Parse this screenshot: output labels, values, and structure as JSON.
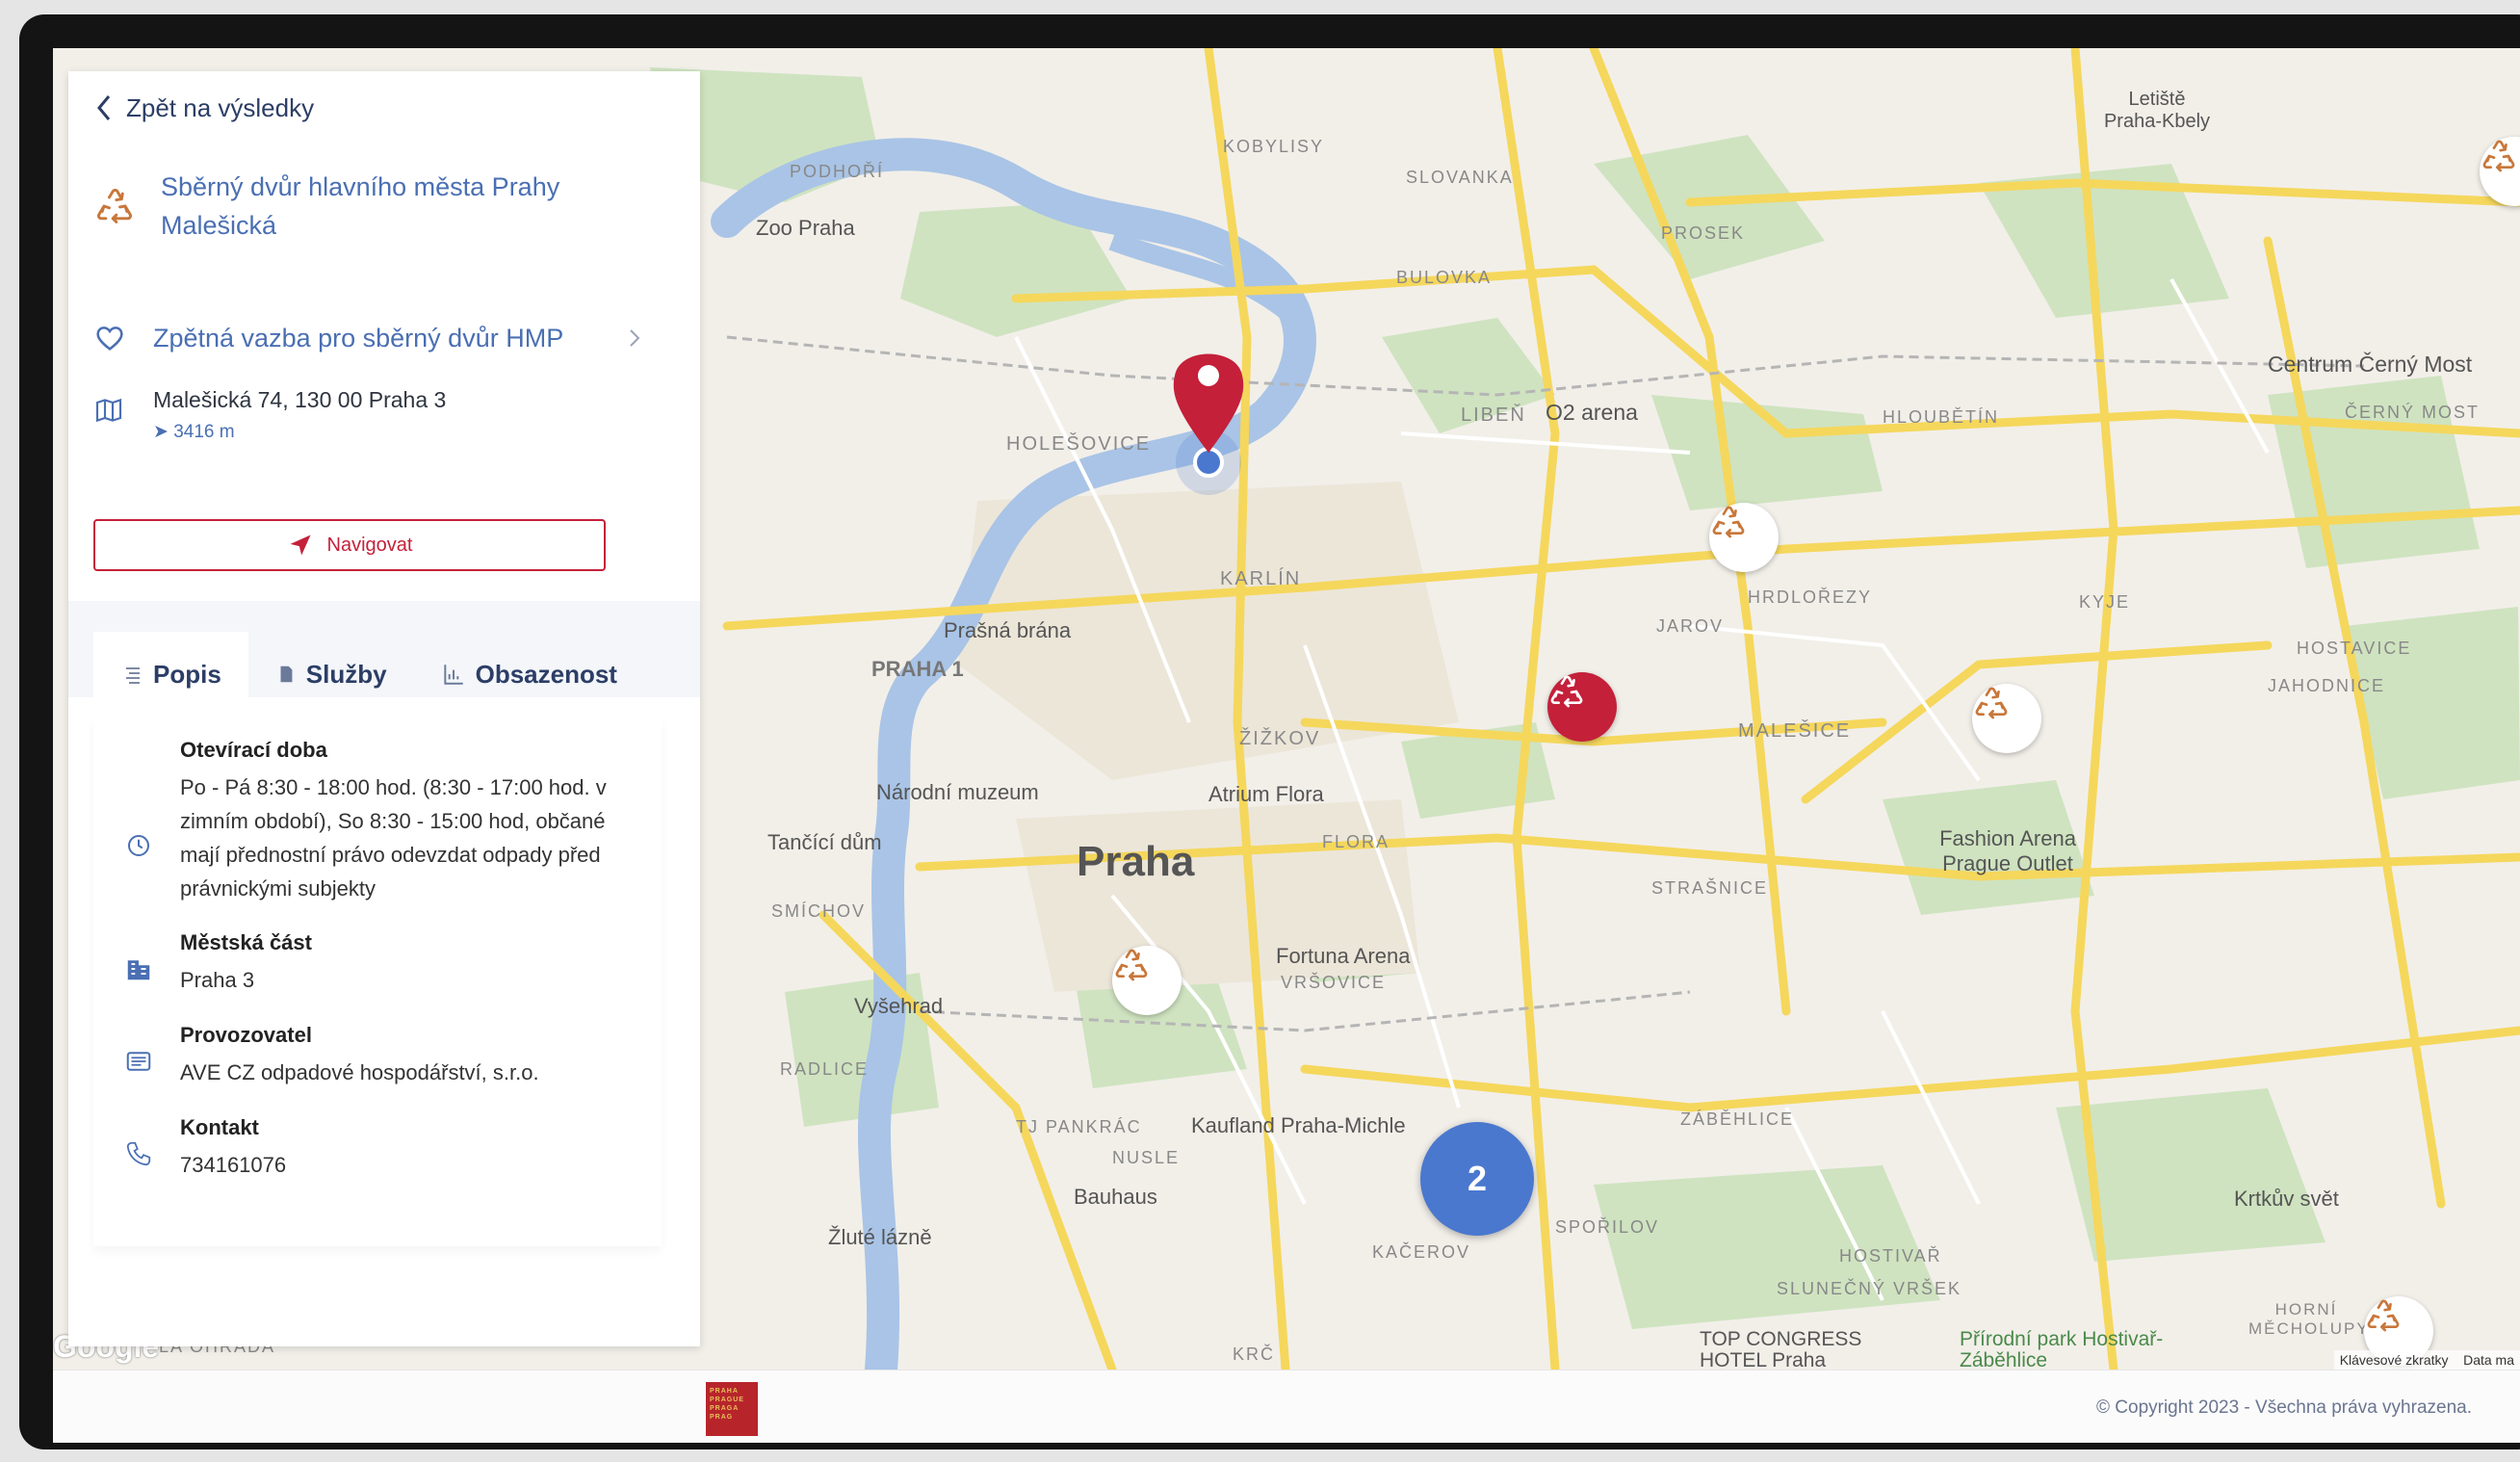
{
  "panel": {
    "back_label": "Zpět na výsledky",
    "title": "Sběrný dvůr hlavního města Prahy Malešická",
    "feedback_label": "Zpětná vazba pro sběrný dvůr HMP",
    "address": "Malešická 74, 130 00 Praha 3",
    "distance": "3416 m",
    "navigate_label": "Navigovat",
    "tabs": [
      {
        "label": "Popis",
        "icon": "list-icon"
      },
      {
        "label": "Služby",
        "icon": "document-icon"
      },
      {
        "label": "Obsazenost",
        "icon": "bar-chart-icon"
      }
    ],
    "details": [
      {
        "label": "Otevírací doba",
        "value": "Po - Pá 8:30 - 18:00 hod. (8:30 - 17:00 hod. v zimním období), So 8:30 - 15:00 hod, občané mají přednostní právo odevzdat odpady před právnickými subjekty",
        "icon": "clock-icon"
      },
      {
        "label": "Městská část",
        "value": "Praha 3",
        "icon": "building-icon"
      },
      {
        "label": "Provozovatel",
        "value": "AVE CZ odpadové hospodářství, s.r.o.",
        "icon": "id-card-icon"
      },
      {
        "label": "Kontakt",
        "value": "734161076",
        "icon": "phone-icon"
      }
    ]
  },
  "map": {
    "cluster_count": "2",
    "google_logo": "Google",
    "attribution_shortcuts": "Klávesové zkratky",
    "attribution_data": "Data ma",
    "labels": [
      {
        "text": "Praha",
        "name": "map-label-praha"
      },
      {
        "text": "PRAHA 1",
        "name": "map-label-praha-1"
      },
      {
        "text": "KARLÍN",
        "name": "map-label-karlin"
      },
      {
        "text": "ŽIŽKOV",
        "name": "map-label-zizkov"
      },
      {
        "text": "HOLEŠOVICE",
        "name": "map-label-holesovice"
      },
      {
        "text": "LIBEŇ",
        "name": "map-label-liben"
      },
      {
        "text": "O2 arena",
        "name": "map-label-o2-arena"
      },
      {
        "text": "HLOUBĚTÍN",
        "name": "map-label-hloubetin"
      },
      {
        "text": "Centrum Černý Most",
        "name": "map-label-cerny-most"
      },
      {
        "text": "HRDLOŘEZY",
        "name": "map-label-hrdlorezy"
      },
      {
        "text": "JAROV",
        "name": "map-label-jarov"
      },
      {
        "text": "MALEŠICE",
        "name": "map-label-malesice"
      },
      {
        "text": "HOSTAVICE",
        "name": "map-label-hostavice"
      },
      {
        "text": "Fashion Arena Prague Outlet",
        "name": "map-label-fashion-arena"
      },
      {
        "text": "STRAŠNICE",
        "name": "map-label-strasnice"
      },
      {
        "text": "VRŠOVICE",
        "name": "map-label-vrsovice"
      },
      {
        "text": "Fortuna Arena",
        "name": "map-label-fortuna-arena"
      },
      {
        "text": "Národní muzeum",
        "name": "map-label-narodni-muzeum"
      },
      {
        "text": "Prašná brána",
        "name": "map-label-prasna-brana"
      },
      {
        "text": "Atrium Flora",
        "name": "map-label-atrium-flora"
      },
      {
        "text": "Tančící dům",
        "name": "map-label-tancici-dum"
      },
      {
        "text": "SMÍCHOV",
        "name": "map-label-smichov"
      },
      {
        "text": "Vyšehrad",
        "name": "map-label-vysehrad"
      },
      {
        "text": "NUSLE",
        "name": "map-label-nusle"
      },
      {
        "text": "TJ PANKRÁC",
        "name": "map-label-pankrac"
      },
      {
        "text": "Kaufland Praha-Michle",
        "name": "map-label-kaufland"
      },
      {
        "text": "Bauhaus",
        "name": "map-label-bauhaus"
      },
      {
        "text": "ZÁBĚHLICE",
        "name": "map-label-zabehlice"
      },
      {
        "text": "Krtkův svět",
        "name": "map-label-krtkuv-svet"
      },
      {
        "text": "SLUNEČNÝ VRŠEK",
        "name": "map-label-slunecny-vrsek"
      },
      {
        "text": "HOSTIVAŘ",
        "name": "map-label-hostivar"
      },
      {
        "text": "TOP CONGRESS HOTEL Praha",
        "name": "map-label-top-congress"
      },
      {
        "text": "Přírodní park Hostivař-Záběhlice",
        "name": "map-label-prirodni-park"
      },
      {
        "text": "KOBYLISY",
        "name": "map-label-kobylisy"
      },
      {
        "text": "PROSEK",
        "name": "map-label-prosek"
      },
      {
        "text": "SLOVANKA",
        "name": "map-label-slovanka"
      },
      {
        "text": "BULOVKA",
        "name": "map-label-bulovka"
      },
      {
        "text": "Letiště Praha-Kbely",
        "name": "map-label-letiste-kbely"
      },
      {
        "text": "Zoo Praha",
        "name": "map-label-zoo-praha"
      },
      {
        "text": "PODHOŘÍ",
        "name": "map-label-podhori"
      },
      {
        "text": "KRČ",
        "name": "map-label-krc"
      },
      {
        "text": "KAČEROV",
        "name": "map-label-kacerov"
      },
      {
        "text": "SPOŘILOV",
        "name": "map-label-sporilov"
      },
      {
        "text": "Žluté lázně",
        "name": "map-label-zlute-lazne"
      },
      {
        "text": "HORNÍ MĚCHOLUPY",
        "name": "map-label-horni-mecholupy"
      },
      {
        "text": "KYJE",
        "name": "map-label-kyje"
      },
      {
        "text": "ČERNÝ MOST",
        "name": "map-label-cerny-most-district"
      },
      {
        "text": "JAHODNICE",
        "name": "map-label-jahodnice"
      },
      {
        "text": "FLORA",
        "name": "map-label-flora"
      },
      {
        "text": "RADLICE",
        "name": "map-label-radlice"
      },
      {
        "text": "LA OHRADA",
        "name": "map-label-la-ohrada"
      }
    ]
  },
  "footer": {
    "copyright": "© Copyright 2023 - Všechna práva vyhrazena.",
    "logo_text": "PRAHA PRAGUE PRAGA PRAG"
  },
  "colors": {
    "accent_red": "#c4203a",
    "link_blue": "#4a6fb3",
    "cluster_blue": "#4a78cf",
    "recycle_orange": "#c8773a"
  }
}
